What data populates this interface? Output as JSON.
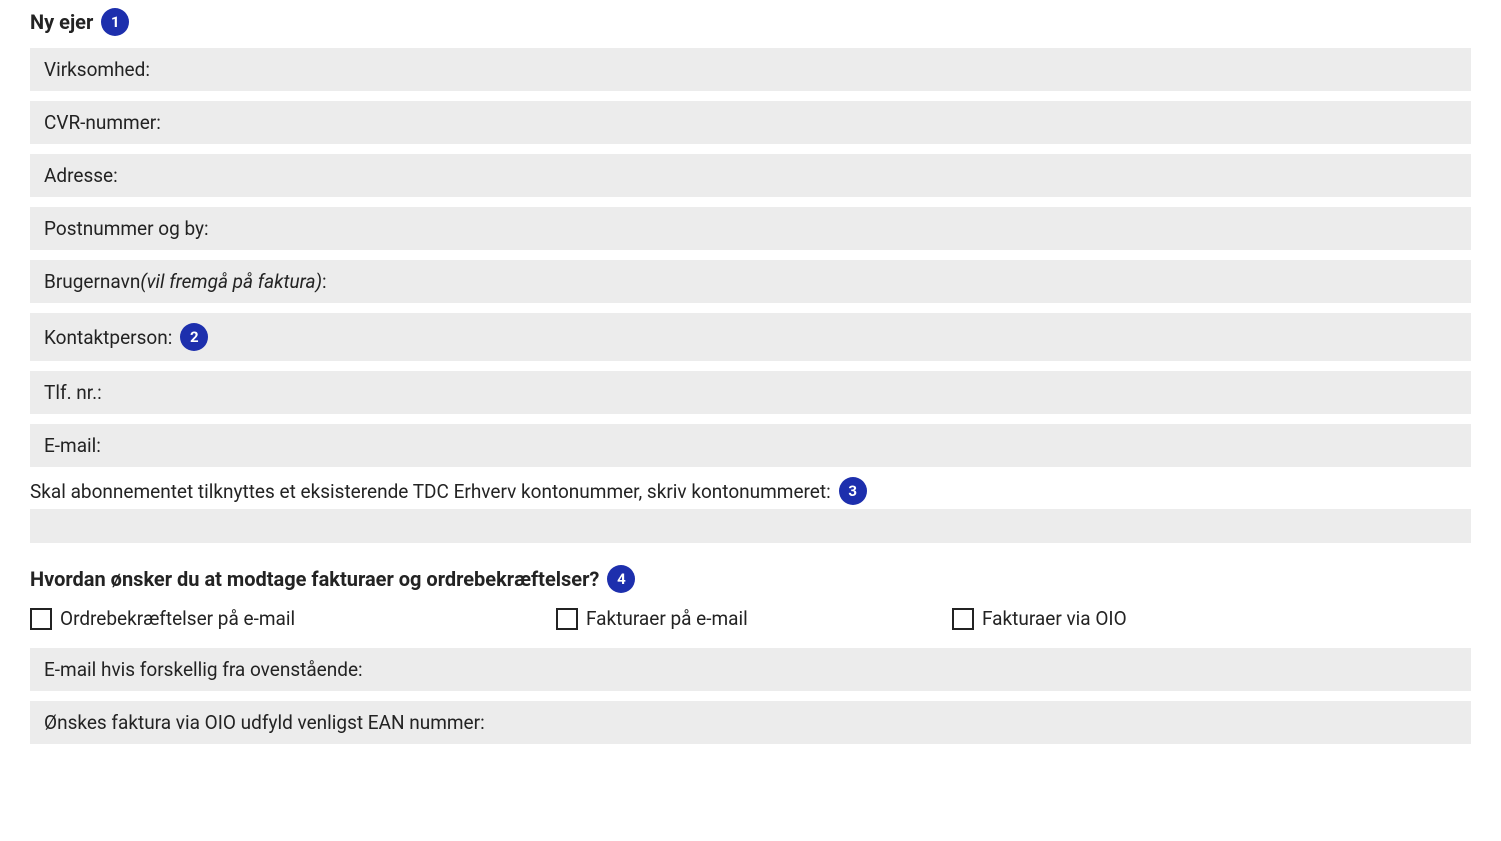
{
  "section1": {
    "heading": "Ny ejer",
    "badge": "1",
    "fields": {
      "virksomhed": "Virksomhed:",
      "cvr": "CVR-nummer:",
      "adresse": "Adresse:",
      "postnummer": "Postnummer og by:",
      "brugernavn_label": "Brugernavn ",
      "brugernavn_hint": "(vil fremgå på faktura)",
      "brugernavn_colon": ":",
      "kontaktperson": "Kontaktperson:",
      "kontaktperson_badge": "2",
      "tlf": "Tlf. nr.:",
      "email": "E-mail:",
      "konto_label": "Skal abonnementet tilknyttes et eksisterende TDC Erhverv kontonummer, skriv kontonummeret:",
      "konto_badge": "3"
    }
  },
  "section2": {
    "heading": "Hvordan ønsker du at modtage fakturaer og ordrebekræftelser?",
    "badge": "4",
    "checkboxes": {
      "ordre_email": "Ordrebekræftelser på e-mail",
      "faktura_email": "Fakturaer på e-mail",
      "faktura_oio": "Fakturaer via OIO"
    },
    "fields": {
      "email_diff": "E-mail hvis forskellig fra ovenstående:",
      "ean": "Ønskes faktura via OIO udfyld venligst EAN nummer:"
    }
  }
}
